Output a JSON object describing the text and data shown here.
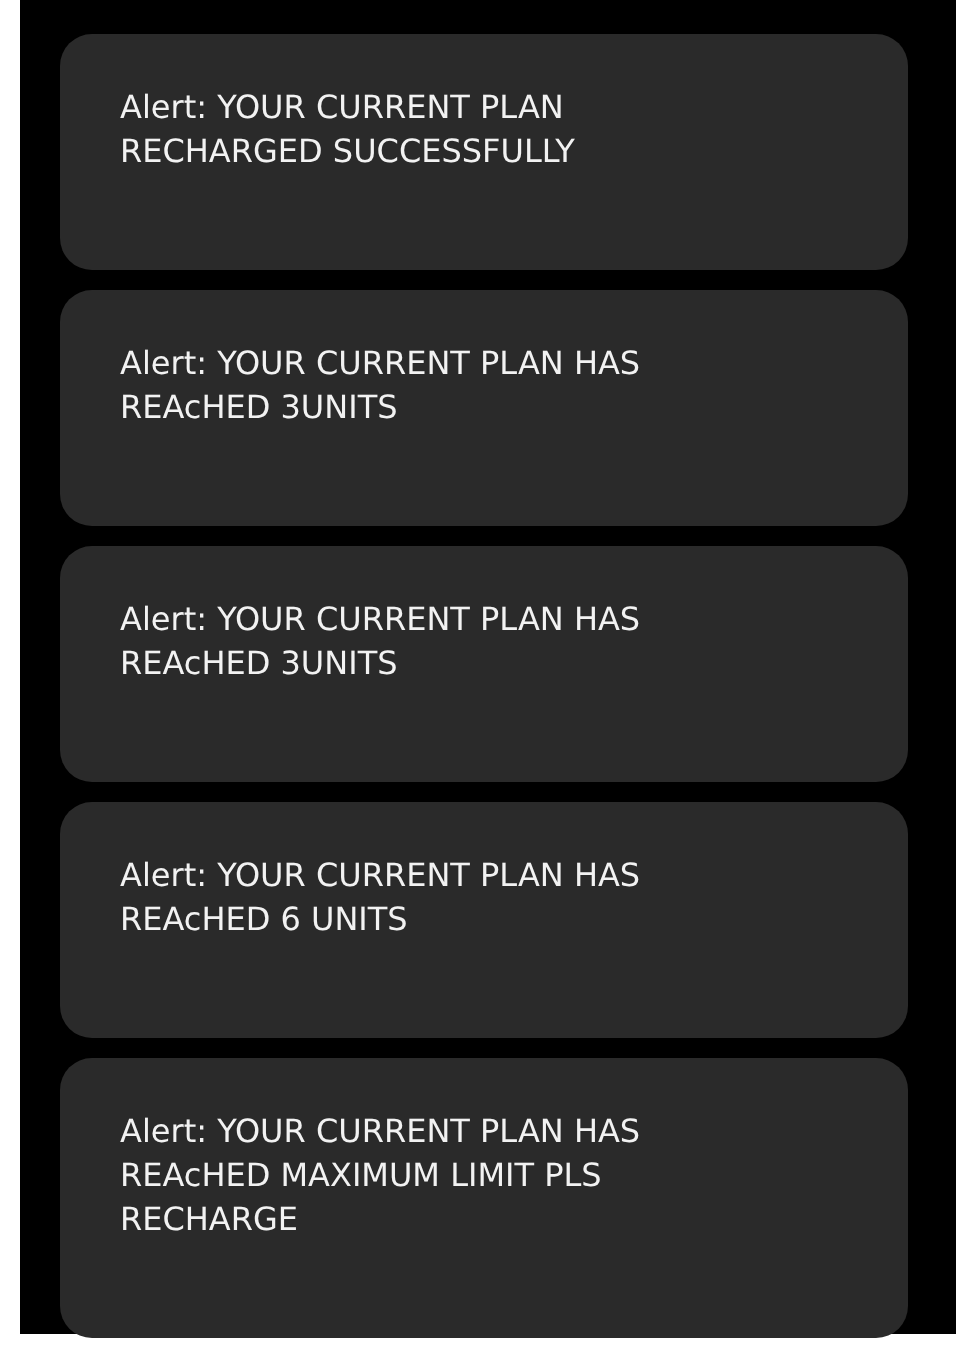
{
  "alerts": [
    {
      "message": "Alert: YOUR CURRENT PLAN\nRECHARGED SUCCESSFULLY"
    },
    {
      "message": "Alert: YOUR CURRENT PLAN HAS\nREAcHED 3UNITS"
    },
    {
      "message": "Alert: YOUR CURRENT PLAN HAS\nREAcHED 3UNITS"
    },
    {
      "message": "Alert: YOUR CURRENT PLAN HAS\nREAcHED 6 UNITS"
    },
    {
      "message": "Alert: YOUR CURRENT PLAN HAS\nREAcHED MAXIMUM LIMIT PLS\nRECHARGE"
    }
  ]
}
